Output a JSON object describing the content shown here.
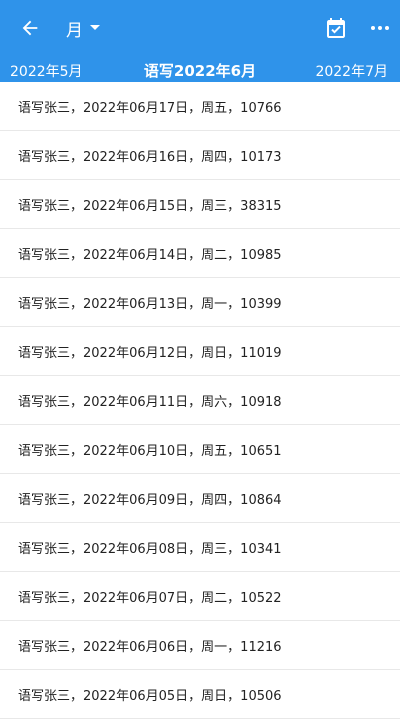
{
  "appbar": {
    "mode_label": "月",
    "icons": [
      "back-arrow-icon",
      "chevron-down-icon",
      "calendar-check-icon",
      "more-horizontal-icon"
    ]
  },
  "months": {
    "prev": "2022年5月",
    "current": "语写2022年6月",
    "next": "2022年7月"
  },
  "records": [
    "语写张三，2022年06月17日，周五，10766",
    "语写张三，2022年06月16日，周四，10173",
    "语写张三，2022年06月15日，周三，38315",
    "语写张三，2022年06月14日，周二，10985",
    "语写张三，2022年06月13日，周一，10399",
    "语写张三，2022年06月12日，周日，11019",
    "语写张三，2022年06月11日，周六，10918",
    "语写张三，2022年06月10日，周五，10651",
    "语写张三，2022年06月09日，周四，10864",
    "语写张三，2022年06月08日，周三，10341",
    "语写张三，2022年06月07日，周二，10522",
    "语写张三，2022年06月06日，周一，11216",
    "语写张三，2022年06月05日，周日，10506"
  ]
}
